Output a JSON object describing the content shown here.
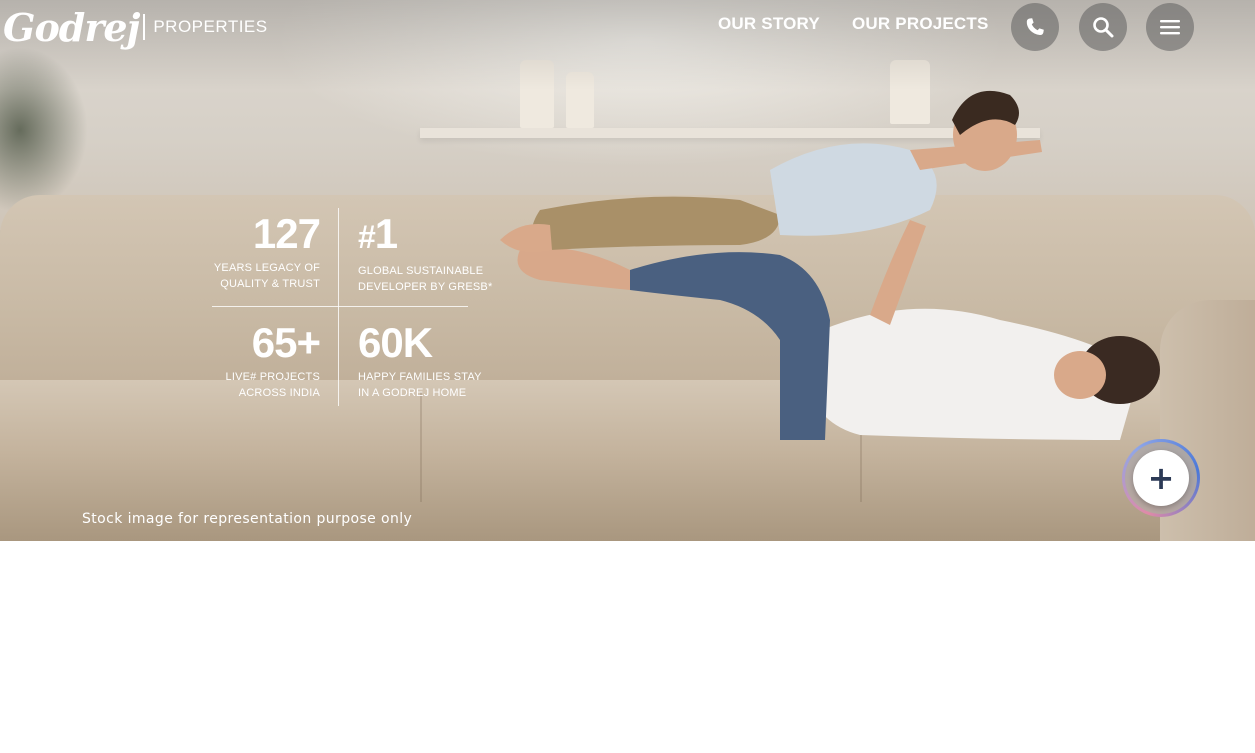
{
  "header": {
    "logo_script": "Godrej",
    "logo_word": "PROPERTIES",
    "nav": [
      {
        "label": "OUR STORY"
      },
      {
        "label": "OUR PROJECTS"
      }
    ],
    "icons": [
      "phone-icon",
      "search-icon",
      "menu-icon"
    ]
  },
  "hero": {
    "stats": [
      {
        "value": "127",
        "label": "YEARS LEGACY OF\nQUALITY & TRUST"
      },
      {
        "value_prefix": "#",
        "value": "1",
        "label": "GLOBAL SUSTAINABLE\nDEVELOPER BY GRESB*"
      },
      {
        "value": "65+",
        "label": "LIVE# PROJECTS\nACROSS INDIA"
      },
      {
        "value": "60K",
        "label": "HAPPY FAMILIES STAY\nIN A GODREJ HOME"
      }
    ],
    "disclaimer": "Stock image for representation purpose only"
  },
  "fab": {
    "label": "+",
    "icon": "plus-icon"
  },
  "colors": {
    "text": "#ffffff",
    "fab_icon": "#2c3a56",
    "page_bg": "#ffffff"
  }
}
